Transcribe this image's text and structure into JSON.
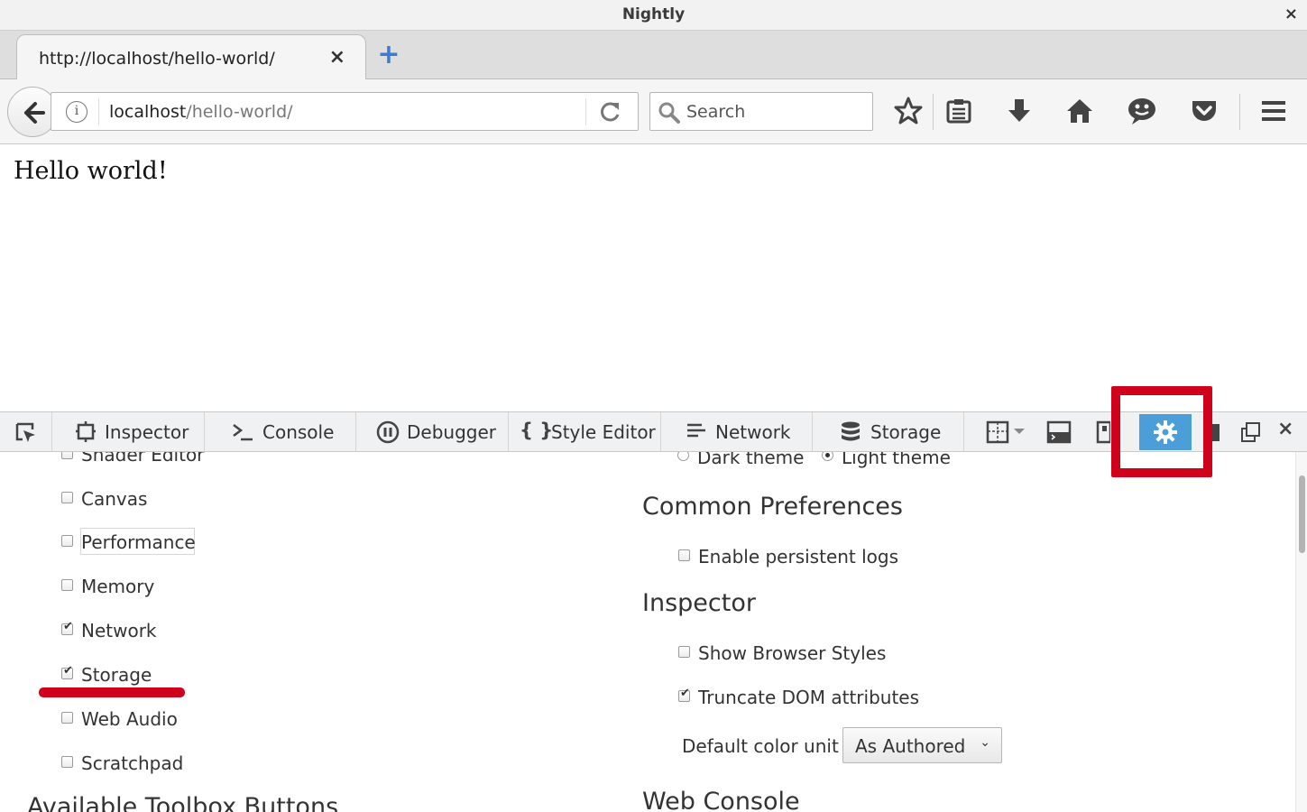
{
  "window": {
    "title": "Nightly",
    "close_glyph": "×"
  },
  "tabs": [
    {
      "label": "http://localhost/hello-world/",
      "close_glyph": "×"
    }
  ],
  "new_tab_glyph": "+",
  "navbar": {
    "url_host": "localhost",
    "url_path": "/hello-world/",
    "search_placeholder": "Search"
  },
  "page": {
    "heading": "Hello world!"
  },
  "devtools": {
    "tabs": [
      {
        "label": "Inspector",
        "icon": "inspector-icon"
      },
      {
        "label": "Console",
        "icon": "console-icon"
      },
      {
        "label": "Debugger",
        "icon": "debugger-icon"
      },
      {
        "label": "Style Editor",
        "icon": "style-editor-icon"
      },
      {
        "label": "Network",
        "icon": "network-icon"
      },
      {
        "label": "Storage",
        "icon": "storage-icon"
      }
    ],
    "close_glyph": "×",
    "settings_accent": "#4c9ed9"
  },
  "options": {
    "tools": [
      {
        "label": "Shader Editor",
        "checked": false
      },
      {
        "label": "Canvas",
        "checked": false
      },
      {
        "label": "Performance",
        "checked": false
      },
      {
        "label": "Memory",
        "checked": false
      },
      {
        "label": "Network",
        "checked": true
      },
      {
        "label": "Storage",
        "checked": true
      },
      {
        "label": "Web Audio",
        "checked": false
      },
      {
        "label": "Scratchpad",
        "checked": false
      }
    ],
    "available_buttons_heading": "Available Toolbox Buttons",
    "themes": [
      {
        "label": "Dark theme",
        "selected": false
      },
      {
        "label": "Light theme",
        "selected": true
      }
    ],
    "common_heading": "Common Preferences",
    "persistent_logs": {
      "label": "Enable persistent logs",
      "checked": false
    },
    "inspector_heading": "Inspector",
    "browser_styles": {
      "label": "Show Browser Styles",
      "checked": false
    },
    "truncate_dom": {
      "label": "Truncate DOM attributes",
      "checked": true
    },
    "color_unit_label": "Default color unit",
    "color_unit_value": "As Authored",
    "web_console_heading": "Web Console"
  },
  "highlight_color": "#d0021b"
}
